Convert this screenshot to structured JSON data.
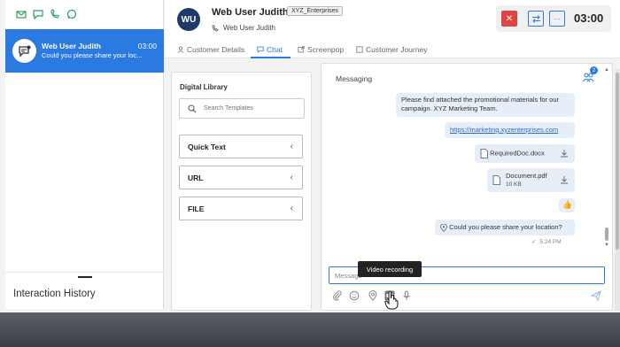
{
  "channels": {
    "icons": [
      "email-icon",
      "chat-icon",
      "phone-chat-icon",
      "whatsapp-icon"
    ]
  },
  "active_interaction": {
    "name": "Web User Judith",
    "time": "03:00",
    "preview": "Could you please share your loc..."
  },
  "interaction_history": {
    "title": "Interaction History"
  },
  "customer": {
    "initials": "WU",
    "name": "Web User Judith",
    "company": "XYZ_Enterprises",
    "subtitle": "Web User Judith"
  },
  "controls": {
    "timer": "03:00",
    "end_color": "#e04545"
  },
  "tabs": [
    {
      "label": "Customer Details"
    },
    {
      "label": "Chat"
    },
    {
      "label": "Screenpop"
    },
    {
      "label": "Customer Journey"
    }
  ],
  "library": {
    "title": "Digital Library",
    "search_placeholder": "Search Templates",
    "items": [
      {
        "label": "Quick Text"
      },
      {
        "label": "URL"
      },
      {
        "label": "FILE"
      }
    ]
  },
  "messaging": {
    "title": "Messaging",
    "participant_count": "2",
    "messages": {
      "promo": "Please find attached the promotional materials for our campaign. XYZ Marketing Team.",
      "link": "https://marketing.xyzenterprises.com",
      "file1": "RequiredDoc.docx",
      "file2_name": "Document.pdf",
      "file2_size": "10 KB",
      "location": "Could you please share your location?",
      "time": "5:24 PM"
    },
    "composer_placeholder": "Message",
    "tooltip": "Video recording"
  },
  "accent_color": "#2a7ae2"
}
